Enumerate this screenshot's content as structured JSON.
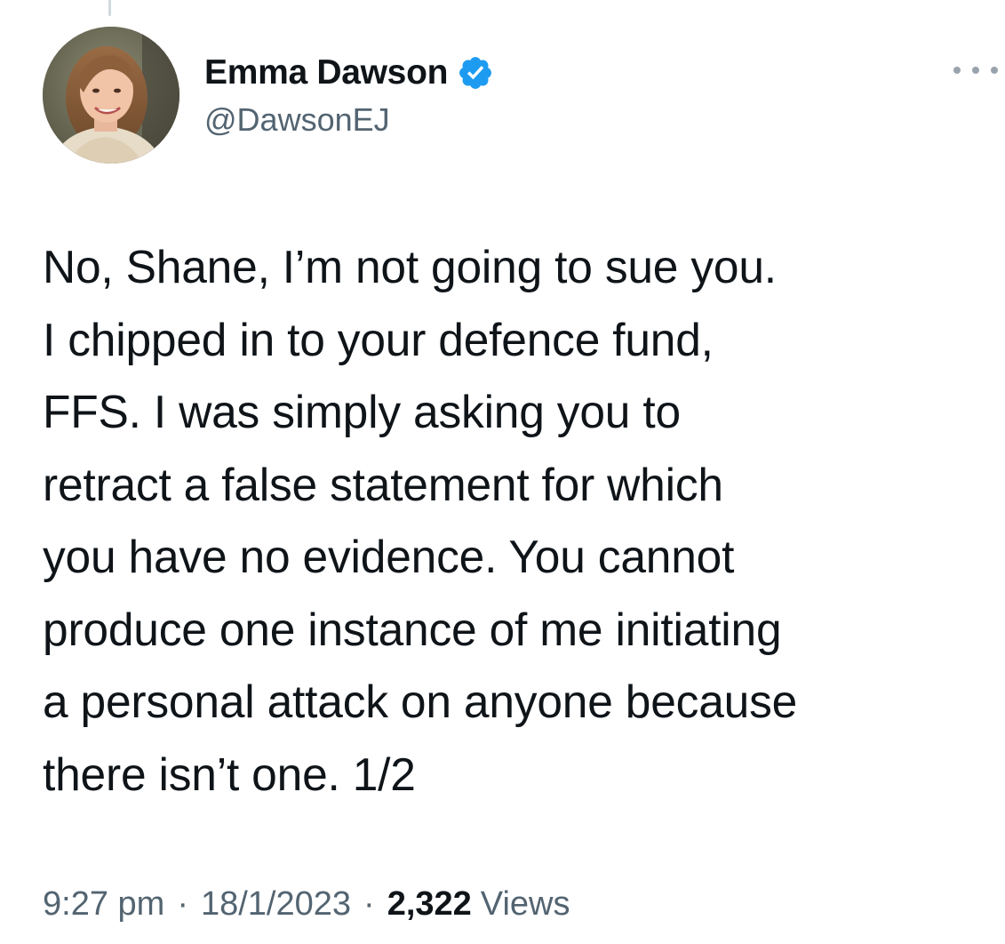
{
  "tweet": {
    "author": {
      "display_name": "Emma Dawson",
      "handle": "@DawsonEJ",
      "verified": true,
      "avatar_icon": "profile-photo"
    },
    "more_icon": "ellipsis-icon",
    "body_lines": [
      "No, Shane, I’m not going to sue you.",
      "I chipped in to your defence fund,",
      "FFS. I was simply asking you to",
      "retract a false statement for which",
      "you have no evidence. You cannot",
      "produce one instance of me initiating",
      "a personal attack on anyone because",
      "there isn’t one. 1/2"
    ],
    "meta": {
      "time": "9:27 pm",
      "separator": "·",
      "date": "18/1/2023",
      "views_count": "2,322",
      "views_label": "Views"
    }
  },
  "colors": {
    "text_primary": "#0f1419",
    "text_secondary": "#536471",
    "verified_blue": "#1d9bf0",
    "thread_line": "#cfd9de"
  }
}
